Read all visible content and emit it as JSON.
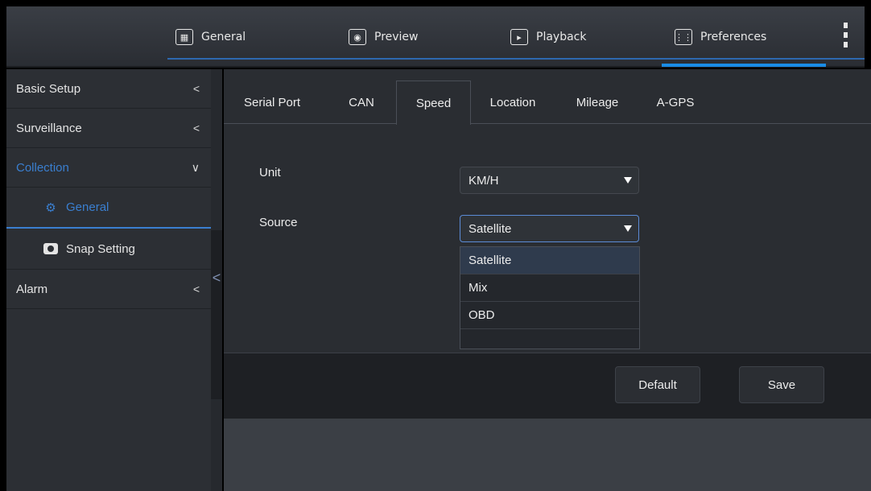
{
  "topnav": {
    "items": [
      {
        "label": "General",
        "icon": "grid-window-icon"
      },
      {
        "label": "Preview",
        "icon": "eye-monitor-icon"
      },
      {
        "label": "Playback",
        "icon": "film-play-icon"
      },
      {
        "label": "Preferences",
        "icon": "sliders-icon"
      }
    ],
    "active_index": 3
  },
  "sidebar": {
    "items": [
      {
        "label": "Basic Setup",
        "chevron": "<"
      },
      {
        "label": "Surveillance",
        "chevron": "<"
      },
      {
        "label": "Collection",
        "chevron": "∨"
      },
      {
        "label": "Alarm",
        "chevron": "<"
      }
    ],
    "sub_items": [
      {
        "label": "General",
        "icon": "gear-icon"
      },
      {
        "label": "Snap Setting",
        "icon": "camera-icon"
      }
    ],
    "collapse_glyph": "<"
  },
  "tabs": {
    "items": [
      "Serial Port",
      "CAN",
      "Speed",
      "Location",
      "Mileage",
      "A-GPS"
    ],
    "active": "Speed"
  },
  "form": {
    "unit_label": "Unit",
    "unit_value": "KM/H",
    "source_label": "Source",
    "source_value": "Satellite",
    "source_options": [
      "Satellite",
      "Mix",
      "OBD"
    ]
  },
  "footer": {
    "default_label": "Default",
    "save_label": "Save"
  },
  "colors": {
    "accent": "#1a8ce6",
    "active_text": "#3a7fd0"
  }
}
